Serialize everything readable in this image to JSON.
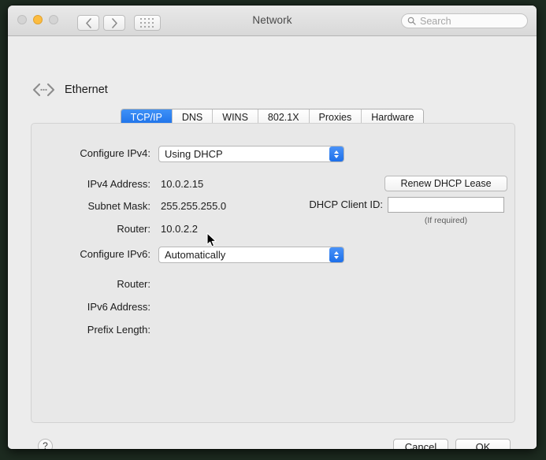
{
  "window": {
    "title": "Network",
    "traffic_lights": [
      "close",
      "minimize",
      "zoom"
    ],
    "nav": {
      "back": "‹",
      "forward": "›",
      "show_all": "grid-icon"
    },
    "search": {
      "placeholder": "Search",
      "value": ""
    }
  },
  "service": {
    "icon": "ethernet-icon",
    "name": "Ethernet"
  },
  "tabs": [
    {
      "label": "TCP/IP",
      "active": true
    },
    {
      "label": "DNS",
      "active": false
    },
    {
      "label": "WINS",
      "active": false
    },
    {
      "label": "802.1X",
      "active": false
    },
    {
      "label": "Proxies",
      "active": false
    },
    {
      "label": "Hardware",
      "active": false
    }
  ],
  "ipv4": {
    "configure_label": "Configure IPv4:",
    "configure_value": "Using DHCP",
    "address_label": "IPv4 Address:",
    "address_value": "10.0.2.15",
    "subnet_label": "Subnet Mask:",
    "subnet_value": "255.255.255.0",
    "router_label": "Router:",
    "router_value": "10.0.2.2"
  },
  "dhcp": {
    "renew_button": "Renew DHCP Lease",
    "client_id_label": "DHCP Client ID:",
    "client_id_value": "",
    "client_id_hint": "(If required)"
  },
  "ipv6": {
    "configure_label": "Configure IPv6:",
    "configure_value": "Automatically",
    "router_label": "Router:",
    "router_value": "",
    "address_label": "IPv6 Address:",
    "address_value": "",
    "prefix_label": "Prefix Length:",
    "prefix_value": ""
  },
  "footer": {
    "help": "?",
    "cancel": "Cancel",
    "ok": "OK"
  },
  "colors": {
    "accent_blue": "#1a6fe8",
    "window_bg": "#ececec",
    "panel_bg": "#e8e8e8",
    "desktop_bg": "#1d2b20"
  }
}
